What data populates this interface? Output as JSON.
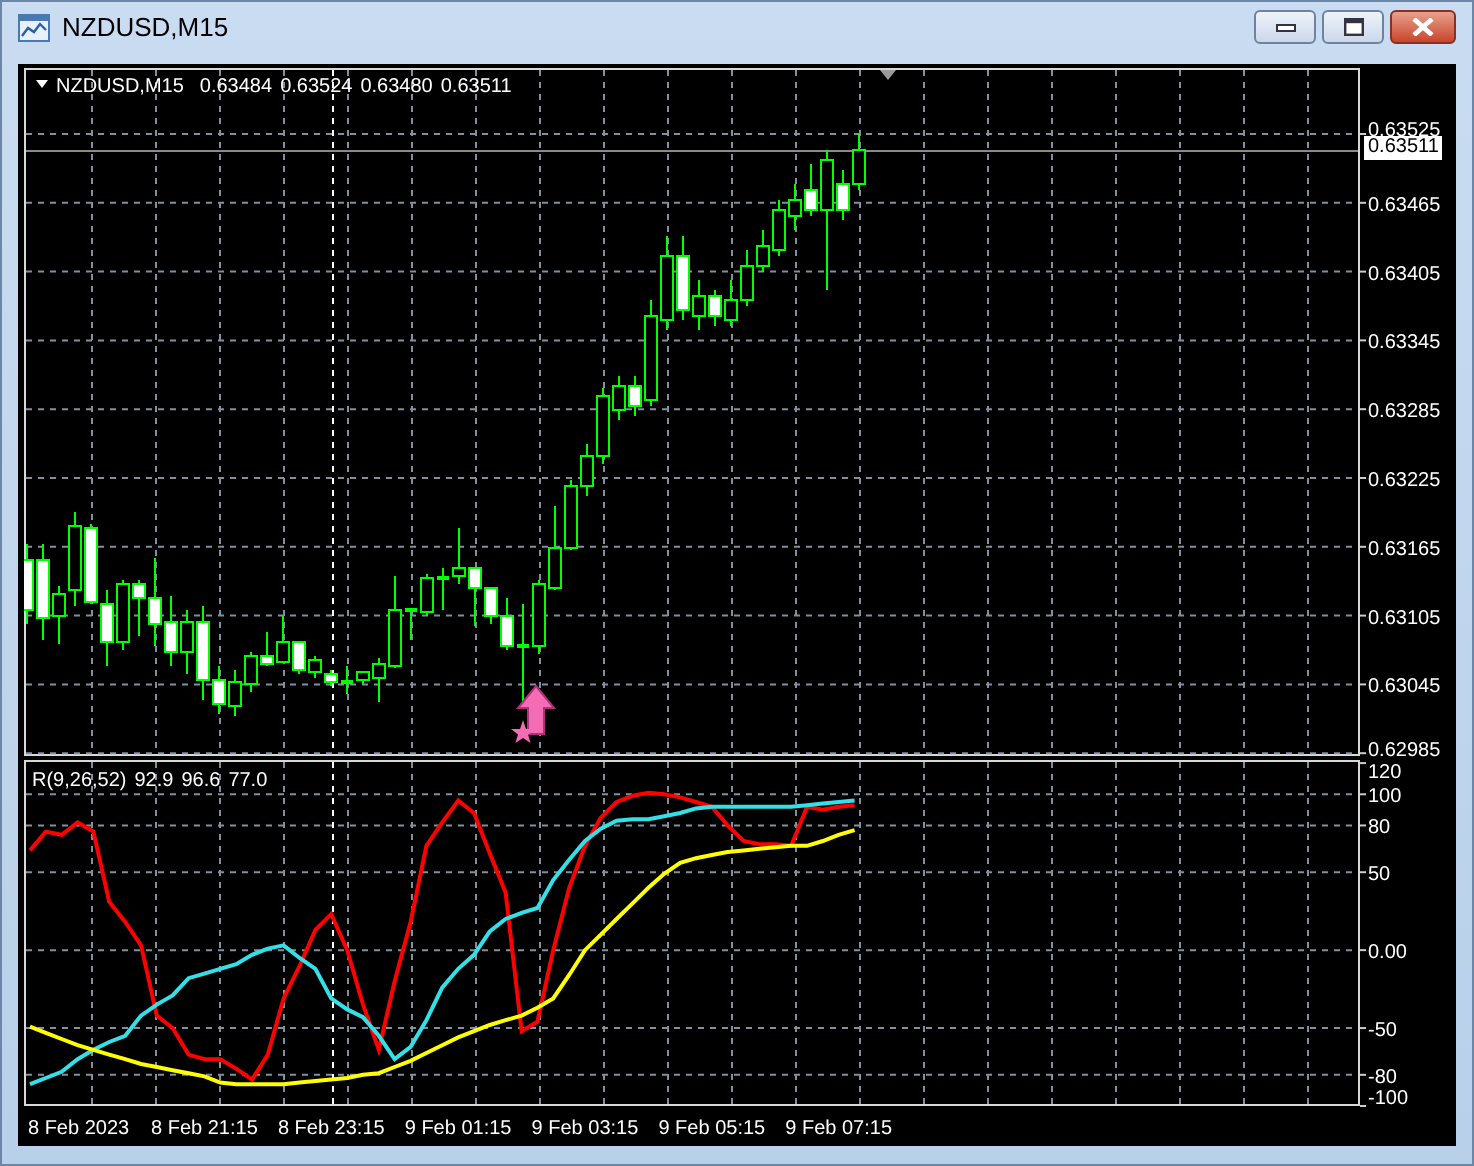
{
  "window": {
    "title": "NZDUSD,M15",
    "buttons": [
      {
        "kind": "minimize"
      },
      {
        "kind": "maximize"
      },
      {
        "kind": "close"
      }
    ]
  },
  "chart": {
    "symbol": "NZDUSD,M15",
    "ohlc": [
      "0.63484",
      "0.63524",
      "0.63480",
      "0.63511"
    ],
    "price_axis": [
      "0.63525",
      "0.63465",
      "0.63405",
      "0.63345",
      "0.63285",
      "0.63225",
      "0.63165",
      "0.63105",
      "0.63045",
      "0.62985"
    ],
    "current_price": "0.63511"
  },
  "indicator": {
    "label": "R(9,26,52)",
    "readings": [
      "92.9",
      "96.6",
      "77.0"
    ],
    "chart_data": {
      "type": "line",
      "categories": [
        null,
        null,
        null,
        "8 Feb 2023",
        null,
        null,
        null,
        null,
        null,
        null,
        null,
        "8 Feb 21:15",
        null,
        null,
        null,
        null,
        null,
        null,
        null,
        "8 Feb 23:15",
        null,
        null,
        null,
        null,
        null,
        null,
        null,
        "9 Feb 01:15",
        null,
        null,
        null,
        null,
        null,
        null,
        null,
        "9 Feb 03:15",
        null,
        null,
        null,
        null,
        null,
        null,
        null,
        "9 Feb 05:15",
        null,
        null,
        null,
        null,
        null,
        null,
        null,
        "9 Feb 07:15",
        null,
        null,
        null,
        null,
        null,
        null,
        null,
        null,
        null,
        null,
        null,
        null,
        null,
        null,
        null,
        null,
        null,
        null,
        null,
        null,
        null,
        null,
        null,
        null,
        null,
        null,
        null,
        null,
        null,
        null,
        null,
        null
      ],
      "ylim": [
        -100,
        122
      ],
      "grid": true,
      "yticks": [
        120,
        100,
        80,
        50,
        {
          "value": 0,
          "label": "0.00"
        },
        -50,
        -80,
        -100
      ],
      "series": [
        {
          "color": "#ff0000",
          "values": [
            64,
            76,
            74,
            82,
            76,
            31,
            18,
            3,
            -42,
            -50,
            -67,
            -70,
            -70,
            -76,
            -83,
            -67,
            -31,
            -10,
            13,
            23,
            0,
            -35,
            -64,
            -20,
            18,
            67,
            82,
            96,
            88,
            62,
            37,
            -52,
            -46,
            0,
            40,
            67,
            85,
            95,
            99,
            101,
            100,
            98,
            95,
            92,
            80,
            70,
            68,
            68,
            67,
            92,
            90,
            92,
            93,
            null,
            null,
            null,
            null,
            null,
            null,
            null,
            null,
            null,
            null,
            null,
            null,
            null,
            null,
            null,
            null,
            null,
            null,
            null,
            null,
            null,
            null,
            null,
            null,
            null,
            null,
            null,
            null,
            null,
            null,
            null
          ]
        },
        {
          "color": "#33e0e8",
          "values": [
            -86,
            -82,
            -78,
            -70,
            -64,
            -59,
            -55,
            -42,
            -35,
            -29,
            -18,
            -15,
            -12,
            -9,
            -3,
            1,
            3,
            -5,
            -12,
            -31,
            -38,
            -43,
            -55,
            -70,
            -62,
            -45,
            -24,
            -12,
            -3,
            12,
            20,
            24,
            27,
            45,
            58,
            70,
            78,
            83,
            84,
            84,
            86,
            88,
            91,
            92,
            92,
            92,
            92,
            92,
            92,
            93,
            94,
            95,
            96,
            null,
            null,
            null,
            null,
            null,
            null,
            null,
            null,
            null,
            null,
            null,
            null,
            null,
            null,
            null,
            null,
            null,
            null,
            null,
            null,
            null,
            null,
            null,
            null,
            null,
            null,
            null,
            null,
            null,
            null,
            null
          ]
        },
        {
          "color": "#ffff00",
          "values": [
            -49,
            -53,
            -57,
            -61,
            -64,
            -67,
            -70,
            -73,
            -75,
            -77,
            -79,
            -81,
            -85,
            -86,
            -86,
            -86,
            -86,
            -85,
            -84,
            -83,
            -82,
            -80,
            -79,
            -75,
            -71,
            -66,
            -61,
            -56,
            -52,
            -48,
            -45,
            -42,
            -37,
            -31,
            -16,
            0,
            10,
            20,
            30,
            40,
            49,
            56,
            59,
            61,
            63,
            64,
            65,
            66,
            67,
            67,
            70,
            74,
            77,
            null,
            null,
            null,
            null,
            null,
            null,
            null,
            null,
            null,
            null,
            null,
            null,
            null,
            null,
            null,
            null,
            null,
            null,
            null,
            null,
            null,
            null,
            null,
            null,
            null,
            null,
            null,
            null,
            null,
            null,
            null
          ]
        }
      ]
    }
  }
}
